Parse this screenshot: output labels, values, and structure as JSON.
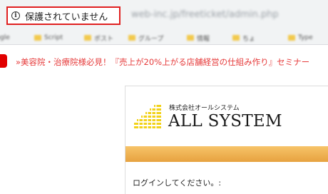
{
  "browser": {
    "security_label": "保護されていません",
    "security_icon": "info-icon",
    "url": "web-inc.jp/freeticket/admin.php",
    "bookmarks": [
      {
        "label": "Google"
      },
      {
        "label": "Script"
      },
      {
        "label": "ポスト"
      },
      {
        "label": "グループ"
      },
      {
        "label": "情報"
      },
      {
        "label": "ちょ"
      },
      {
        "label": "Type"
      }
    ]
  },
  "ticker": {
    "text": "»美容院・治療院様必見！『売上が20%上がる店舗経営の仕組み作り』セミナー"
  },
  "login": {
    "company_small": "株式会社オールシステム",
    "company_wordmark": "ALL SYSTEM",
    "prompt": "ログインしてください。:"
  },
  "colors": {
    "highlight_border": "#e02020",
    "ticker_text": "#e63b3b",
    "logo_yellow": "#f2d21a",
    "band_orange": "#eaa845"
  }
}
